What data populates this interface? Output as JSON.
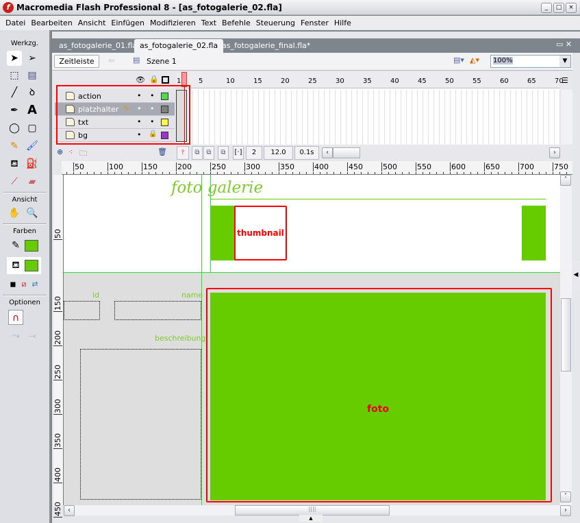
{
  "window": {
    "title": "Macromedia Flash Professional 8 - [as_fotogalerie_02.fla]",
    "logo": "f",
    "controls": [
      "_",
      "□",
      "×"
    ]
  },
  "menu": [
    "Datei",
    "Bearbeiten",
    "Ansicht",
    "Einfügen",
    "Modifizieren",
    "Text",
    "Befehle",
    "Steuerung",
    "Fenster",
    "Hilfe"
  ],
  "toolbox": {
    "title": "Werkzg.",
    "view": "Ansicht",
    "colors": "Farben",
    "options": "Optionen",
    "stroke_color": "#66cc00",
    "fill_color": "#66cc00"
  },
  "tabs": [
    "as_fotogalerie_01.fla",
    "as_fotogalerie_02.fla",
    "as_fotogalerie_final.fla*"
  ],
  "editbar": {
    "timeline_button": "Zeitleiste",
    "scene": "Szene 1",
    "zoom": "100%"
  },
  "timeline": {
    "layers": [
      {
        "name": "action",
        "color": "#4cdc4c",
        "locked": false,
        "selected": false
      },
      {
        "name": "platzhalter",
        "color": "#808080",
        "locked": false,
        "selected": true
      },
      {
        "name": "txt",
        "color": "#ffff44",
        "locked": false,
        "selected": false
      },
      {
        "name": "bg",
        "color": "#9933cc",
        "locked": true,
        "selected": false
      }
    ],
    "frame_numbers": [
      "1",
      "5",
      "10",
      "15",
      "20",
      "25",
      "30",
      "35",
      "40",
      "45",
      "50",
      "55",
      "60",
      "65",
      "70"
    ],
    "current_frame": "2",
    "frame_rate": "12.0 BpS",
    "elapsed": "0.1s"
  },
  "rulers": {
    "h": [
      "50",
      "100",
      "150",
      "200",
      "250",
      "300",
      "350",
      "400",
      "450",
      "500",
      "550",
      "600",
      "650",
      "700",
      "750"
    ],
    "v": [
      "50",
      "150",
      "200",
      "250",
      "300",
      "350",
      "400",
      "450"
    ]
  },
  "stage": {
    "heading": "foto galerie",
    "thumbnail": "thumbnail",
    "foto": "foto",
    "id": "id",
    "name": "name",
    "beschreibung": "beschreibung",
    "accent": "#66cc00",
    "highlight": "#ff0000"
  }
}
